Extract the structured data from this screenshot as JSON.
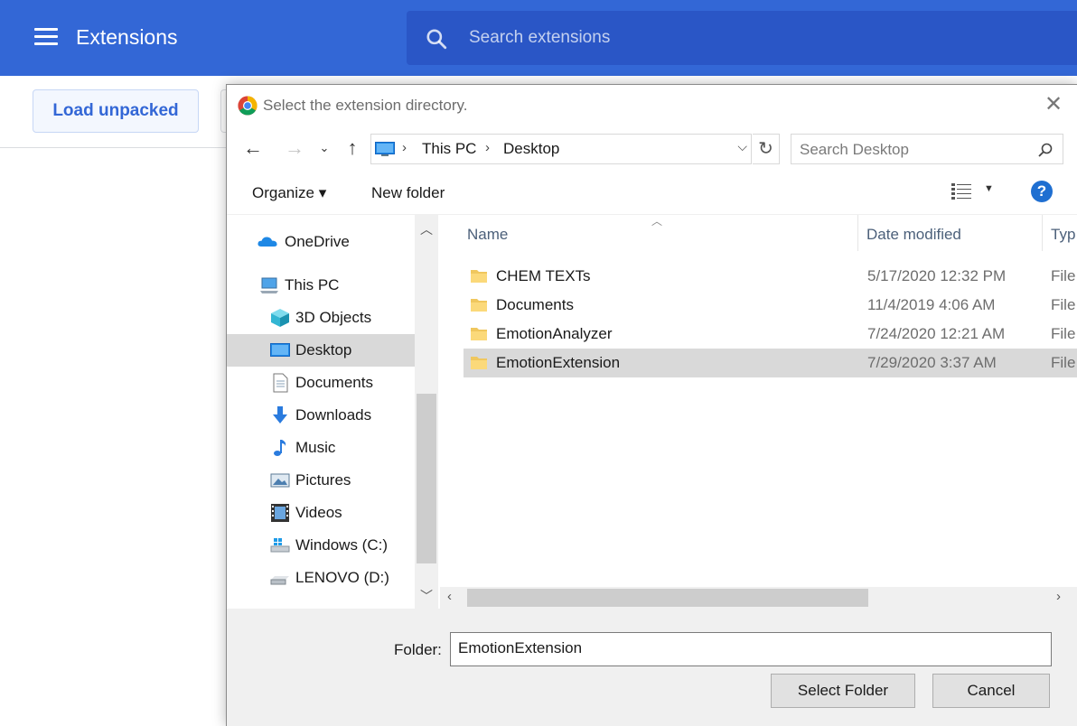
{
  "extensions_page": {
    "title": "Extensions",
    "search_placeholder": "Search extensions",
    "load_unpacked_label": "Load unpacked",
    "brand_color": "#3367d6"
  },
  "dialog": {
    "title": "Select the extension directory.",
    "address": {
      "crumbs": [
        "This PC",
        "Desktop"
      ]
    },
    "search_placeholder": "Search Desktop",
    "commands": {
      "organize": "Organize ▾",
      "new_folder": "New folder",
      "help": "?"
    },
    "nav_tree": [
      {
        "label": "OneDrive",
        "icon": "onedrive-icon",
        "selected": false
      },
      {
        "label": "This PC",
        "icon": "computer-icon",
        "selected": false
      },
      {
        "label": "3D Objects",
        "icon": "3d-objects-icon",
        "selected": false
      },
      {
        "label": "Desktop",
        "icon": "desktop-icon",
        "selected": true
      },
      {
        "label": "Documents",
        "icon": "documents-icon",
        "selected": false
      },
      {
        "label": "Downloads",
        "icon": "downloads-icon",
        "selected": false
      },
      {
        "label": "Music",
        "icon": "music-icon",
        "selected": false
      },
      {
        "label": "Pictures",
        "icon": "pictures-icon",
        "selected": false
      },
      {
        "label": "Videos",
        "icon": "videos-icon",
        "selected": false
      },
      {
        "label": "Windows (C:)",
        "icon": "drive-c-icon",
        "selected": false
      },
      {
        "label": "LENOVO (D:)",
        "icon": "drive-d-icon",
        "selected": false
      }
    ],
    "columns": {
      "name": "Name",
      "date_modified": "Date modified",
      "type": "Typ"
    },
    "files": [
      {
        "name": "CHEM TEXTs",
        "date": "5/17/2020 12:32 PM",
        "type": "File",
        "selected": false
      },
      {
        "name": "Documents",
        "date": "11/4/2019 4:06 AM",
        "type": "File",
        "selected": false
      },
      {
        "name": "EmotionAnalyzer",
        "date": "7/24/2020 12:21 AM",
        "type": "File",
        "selected": false
      },
      {
        "name": "EmotionExtension",
        "date": "7/29/2020 3:37 AM",
        "type": "File",
        "selected": true
      }
    ],
    "footer": {
      "folder_label": "Folder:",
      "folder_value": "EmotionExtension",
      "select_label": "Select Folder",
      "cancel_label": "Cancel"
    }
  }
}
